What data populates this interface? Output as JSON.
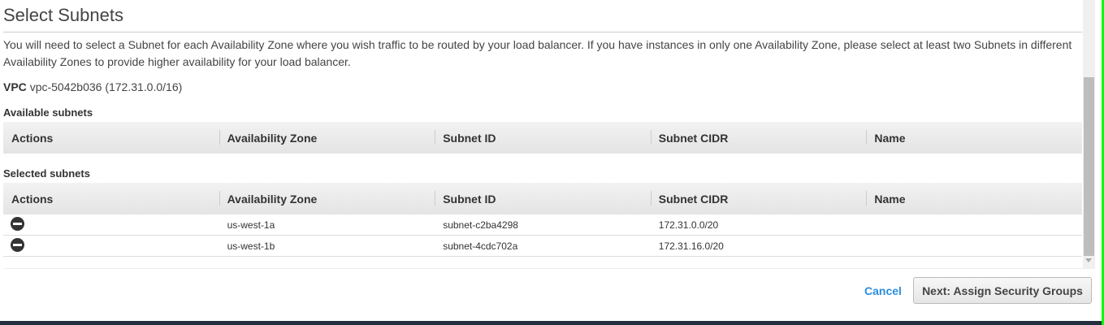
{
  "title": "Select Subnets",
  "description": "You will need to select a Subnet for each Availability Zone where you wish traffic to be routed by your load balancer. If you have instances in only one Availability Zone, please select at least two Subnets in different Availability Zones to provide higher availability for your load balancer.",
  "vpc": {
    "label": "VPC",
    "value": "vpc-5042b036 (172.31.0.0/16)"
  },
  "available": {
    "heading": "Available subnets",
    "columns": [
      "Actions",
      "Availability Zone",
      "Subnet ID",
      "Subnet CIDR",
      "Name"
    ]
  },
  "selected": {
    "heading": "Selected subnets",
    "columns": [
      "Actions",
      "Availability Zone",
      "Subnet ID",
      "Subnet CIDR",
      "Name"
    ],
    "rows": [
      {
        "az": "us-west-1a",
        "subnet_id": "subnet-c2ba4298",
        "cidr": "172.31.0.0/20",
        "name": ""
      },
      {
        "az": "us-west-1b",
        "subnet_id": "subnet-4cdc702a",
        "cidr": "172.31.16.0/20",
        "name": ""
      }
    ]
  },
  "footer": {
    "cancel": "Cancel",
    "next": "Next: Assign Security Groups"
  }
}
